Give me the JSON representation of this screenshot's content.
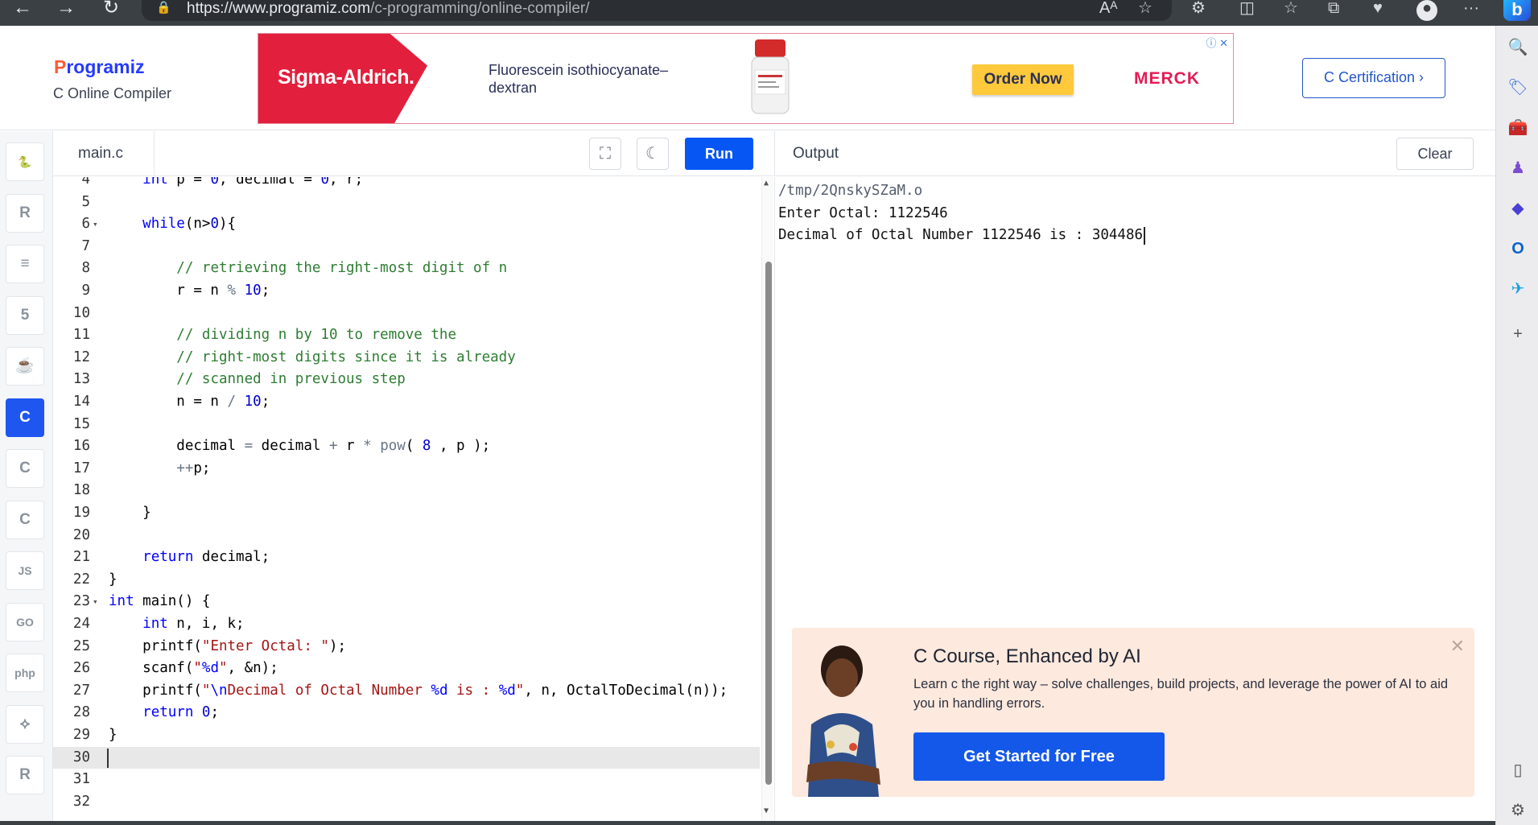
{
  "browser": {
    "url_host": "https://www.programiz.com",
    "url_path": "/c-programming/online-compiler/"
  },
  "header": {
    "logo_p": "P",
    "logo_rest": "rogramiz",
    "subtitle": "C Online Compiler",
    "cert_button": "C Certification ›"
  },
  "ad": {
    "brand": "Sigma-Aldrich.",
    "product_line1": "Fluorescein isothiocyanate–",
    "product_line2": "dextran",
    "order_button": "Order Now",
    "merck": "MERCK"
  },
  "languages": [
    {
      "name": "python",
      "glyph": "🐍"
    },
    {
      "name": "r",
      "glyph": "R"
    },
    {
      "name": "sql",
      "glyph": "≡"
    },
    {
      "name": "html",
      "glyph": "5"
    },
    {
      "name": "java",
      "glyph": "☕"
    },
    {
      "name": "c",
      "glyph": "C",
      "active": true
    },
    {
      "name": "cpp",
      "glyph": "C"
    },
    {
      "name": "csharp",
      "glyph": "C"
    },
    {
      "name": "javascript",
      "glyph": "JS"
    },
    {
      "name": "go",
      "glyph": "GO"
    },
    {
      "name": "php",
      "glyph": "php"
    },
    {
      "name": "swift",
      "glyph": "⟡"
    },
    {
      "name": "rust",
      "glyph": "R"
    }
  ],
  "editor": {
    "filename": "main.c",
    "run_label": "Run",
    "lines": [
      {
        "n": "4",
        "html": "    <span class=\"k\">int</span> p = <span class=\"n\">0</span>, decimal = <span class=\"n\">0</span>, r;"
      },
      {
        "n": "5",
        "html": ""
      },
      {
        "n": "6",
        "fold": true,
        "html": "    <span class=\"k\">while</span>(n&gt;<span class=\"n\">0</span>){"
      },
      {
        "n": "7",
        "html": ""
      },
      {
        "n": "8",
        "html": "        <span class=\"c\">// retrieving the right-most digit of n</span>"
      },
      {
        "n": "9",
        "html": "        r = n <span class=\"o\">%</span> <span class=\"n\">10</span>;"
      },
      {
        "n": "10",
        "html": ""
      },
      {
        "n": "11",
        "html": "        <span class=\"c\">// dividing n by 10 to remove the</span>"
      },
      {
        "n": "12",
        "html": "        <span class=\"c\">// right-most digits since it is already</span>"
      },
      {
        "n": "13",
        "html": "        <span class=\"c\">// scanned in previous step</span>"
      },
      {
        "n": "14",
        "html": "        n = n <span class=\"o\">/</span> <span class=\"n\">10</span>;"
      },
      {
        "n": "15",
        "html": ""
      },
      {
        "n": "16",
        "html": "        decimal <span class=\"o\">=</span> decimal <span class=\"o\">+</span> r <span class=\"o\">*</span> <span class=\"o\">pow</span>( <span class=\"n\">8</span> , p );"
      },
      {
        "n": "17",
        "html": "        <span class=\"o\">++</span>p;"
      },
      {
        "n": "18",
        "html": ""
      },
      {
        "n": "19",
        "html": "    }"
      },
      {
        "n": "20",
        "html": ""
      },
      {
        "n": "21",
        "html": "    <span class=\"k\">return</span> decimal;"
      },
      {
        "n": "22",
        "html": "}"
      },
      {
        "n": "23",
        "fold": true,
        "html": "<span class=\"k\">int</span> main() {"
      },
      {
        "n": "24",
        "html": "    <span class=\"k\">int</span> n, i, k;"
      },
      {
        "n": "25",
        "html": "    printf(<span class=\"s\">\"Enter Octal: \"</span>);"
      },
      {
        "n": "26",
        "html": "    scanf(<span class=\"s\">\"<span class=\"k\">%d</span>\"</span>, &amp;n);"
      },
      {
        "n": "27",
        "html": "    printf(<span class=\"s\">\"<span class=\"k\">\\n</span>Decimal of Octal Number <span class=\"k\">%d</span> is : <span class=\"k\">%d</span>\"</span>, n, OctalToDecimal(n));"
      },
      {
        "n": "28",
        "html": "    <span class=\"k\">return</span> <span class=\"n\">0</span>;"
      },
      {
        "n": "29",
        "html": "}"
      },
      {
        "n": "30",
        "current": true,
        "html": ""
      },
      {
        "n": "31",
        "html": ""
      },
      {
        "n": "32",
        "html": ""
      }
    ]
  },
  "output": {
    "title": "Output",
    "clear_label": "Clear",
    "lines": [
      "/tmp/2QnskySZaM.o",
      "Enter Octal: 1122546",
      "Decimal of Octal Number 1122546 is : 304486"
    ]
  },
  "course": {
    "title": "C Course, Enhanced by AI",
    "desc": "Learn c the right way – solve challenges, build projects, and leverage the power of AI to aid you in handling errors.",
    "cta": "Get Started for Free"
  }
}
